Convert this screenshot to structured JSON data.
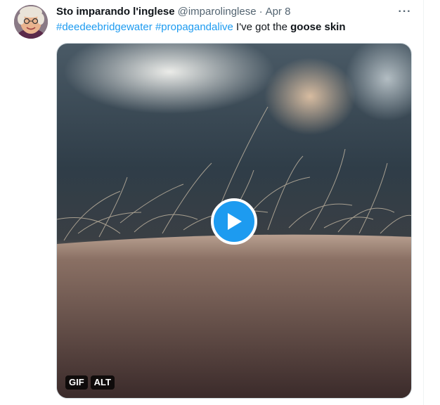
{
  "tweet": {
    "display_name": "Sto imparando l'inglese",
    "handle": "@imparolinglese",
    "separator": "·",
    "date": "Apr 8",
    "more_label": "···",
    "text": {
      "hashtag1": "#deedeebridgewater",
      "space1": " ",
      "hashtag2": "#propagandalive",
      "plain": " I've got the ",
      "bold": "goose skin"
    },
    "media": {
      "type": "gif",
      "badge_gif": "GIF",
      "badge_alt": "ALT",
      "icon": "play-icon"
    }
  },
  "colors": {
    "accent": "#1d9bf0",
    "text_primary": "#0f1419",
    "text_secondary": "#536471"
  }
}
